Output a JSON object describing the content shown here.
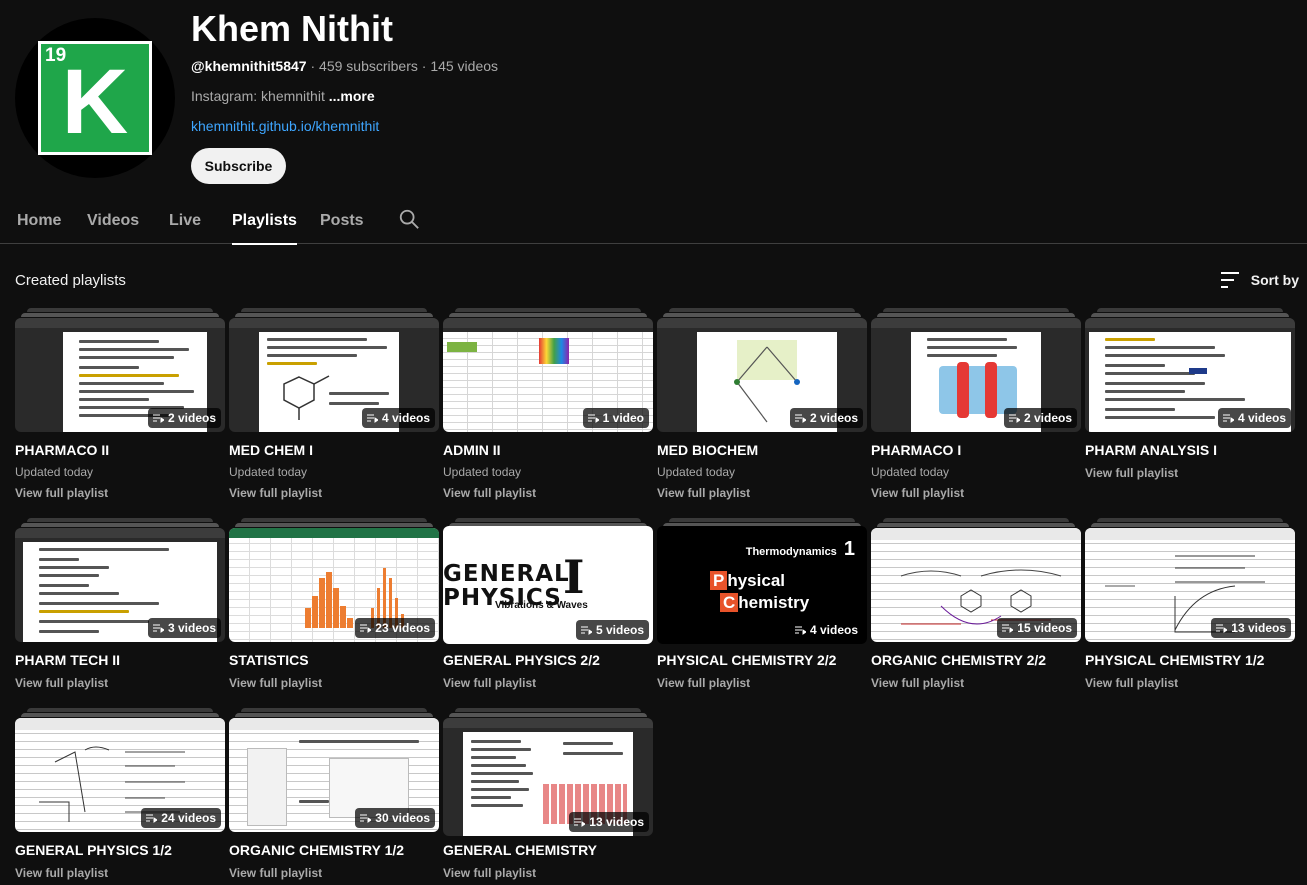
{
  "channel": {
    "name": "Khem Nithit",
    "avatar_number": "19",
    "avatar_letter": "K",
    "handle": "@khemnithit5847",
    "subscribers": "459 subscribers",
    "videos": "145 videos",
    "sep": "·",
    "description": "Instagram: khemnithit",
    "more": "...more",
    "link": "khemnithit.github.io/khemnithit",
    "subscribe_label": "Subscribe",
    "avatar_color": "#1fa64a"
  },
  "tabs": [
    {
      "label": "Home"
    },
    {
      "label": "Videos"
    },
    {
      "label": "Live"
    },
    {
      "label": "Playlists",
      "active": true
    },
    {
      "label": "Posts"
    }
  ],
  "section": {
    "title": "Created playlists",
    "sort_label": "Sort by"
  },
  "playlists": [
    {
      "title": "PHARMACO II",
      "count": "2 videos",
      "updated": "Updated today",
      "link": "View full playlist"
    },
    {
      "title": "MED CHEM I",
      "count": "4 videos",
      "updated": "Updated today",
      "link": "View full playlist"
    },
    {
      "title": "ADMIN II",
      "count": "1 video",
      "updated": "Updated today",
      "link": "View full playlist"
    },
    {
      "title": "MED BIOCHEM",
      "count": "2 videos",
      "updated": "Updated today",
      "link": "View full playlist"
    },
    {
      "title": "PHARMACO I",
      "count": "2 videos",
      "updated": "Updated today",
      "link": "View full playlist"
    },
    {
      "title": "PHARM ANALYSIS I",
      "count": "4 videos",
      "link": "View full playlist"
    },
    {
      "title": "PHARM TECH II",
      "count": "3 videos",
      "link": "View full playlist"
    },
    {
      "title": "STATISTICS",
      "count": "23 videos",
      "link": "View full playlist"
    },
    {
      "title": "GENERAL PHYSICS 2/2",
      "count": "5 videos",
      "link": "View full playlist",
      "thumb_text": {
        "big": "GENERAL PHYSICS",
        "numeral": "I",
        "sub": "Vibrations & Waves"
      }
    },
    {
      "title": "PHYSICAL CHEMISTRY 2/2",
      "count": "4 videos",
      "link": "View full playlist",
      "thumb_text": {
        "top": "Thermodynamics",
        "num": "1",
        "p": "P",
        "hysical": "hysical",
        "c": "C",
        "hemistry": "hemistry"
      }
    },
    {
      "title": "ORGANIC CHEMISTRY 2/2",
      "count": "15 videos",
      "link": "View full playlist"
    },
    {
      "title": "PHYSICAL CHEMISTRY 1/2",
      "count": "13 videos",
      "link": "View full playlist"
    },
    {
      "title": "GENERAL PHYSICS 1/2",
      "count": "24 videos",
      "link": "View full playlist"
    },
    {
      "title": "ORGANIC CHEMISTRY 1/2",
      "count": "30 videos",
      "link": "View full playlist"
    },
    {
      "title": "GENERAL CHEMISTRY",
      "count": "13 videos",
      "link": "View full playlist"
    }
  ],
  "icons": {
    "search": "search-icon",
    "sort": "sort-icon",
    "playlist": "playlist-icon"
  }
}
